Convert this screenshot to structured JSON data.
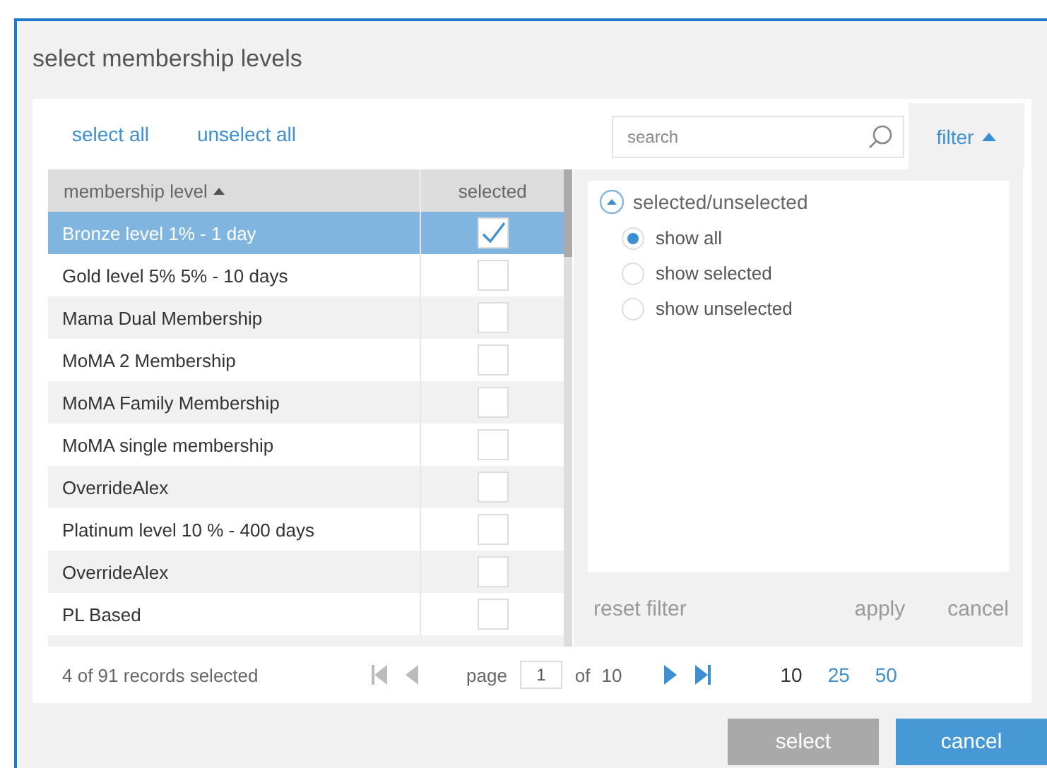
{
  "dialog": {
    "title": "select membership levels"
  },
  "toolbar": {
    "links": [
      "select all",
      "unselect all"
    ],
    "search": {
      "placeholder": "search"
    },
    "filter_tab": {
      "label": "filter",
      "expanded": true
    }
  },
  "table": {
    "columns": [
      {
        "label": "membership level",
        "sorted": true
      },
      {
        "label": "selected",
        "sorted": false
      }
    ],
    "rows": [
      {
        "name": "Bronze level 1% - 1 day",
        "selected": true
      },
      {
        "name": "Gold level 5% 5% - 10 days",
        "selected": false
      },
      {
        "name": "Mama Dual Membership",
        "selected": false
      },
      {
        "name": "MoMA 2 Membership",
        "selected": false
      },
      {
        "name": "MoMA Family Membership",
        "selected": false
      },
      {
        "name": "MoMA single membership",
        "selected": false
      },
      {
        "name": "OverrideAlex",
        "selected": false
      },
      {
        "name": "Platinum level 10 % - 400 days",
        "selected": false
      },
      {
        "name": "OverrideAlex",
        "selected": false
      },
      {
        "name": "PL Based",
        "selected": false
      }
    ]
  },
  "filter": {
    "group": {
      "label": "selected/unselected",
      "expanded": true
    },
    "options": [
      {
        "label": "show all",
        "selected": true
      },
      {
        "label": "show selected",
        "selected": false
      },
      {
        "label": "show unselected",
        "selected": false
      }
    ],
    "buttons": [
      {
        "label": "reset filter",
        "disabled": true
      },
      {
        "label": "apply",
        "disabled": true
      },
      {
        "label": "cancel",
        "disabled": true
      }
    ]
  },
  "footer": {
    "summary": "4 of 91 records selected",
    "pager": {
      "first_disabled": true,
      "prev_disabled": true,
      "next_disabled": false,
      "last_disabled": false,
      "page_label": "page",
      "page": "1",
      "of_label": "of",
      "total": "10"
    },
    "page_sizes": [
      {
        "label": "10",
        "selected": true
      },
      {
        "label": "25",
        "selected": false
      },
      {
        "label": "50",
        "selected": false
      }
    ]
  },
  "buttons": [
    {
      "label": "select",
      "kind": "secondary"
    },
    {
      "label": "cancel",
      "kind": "primary"
    }
  ]
}
